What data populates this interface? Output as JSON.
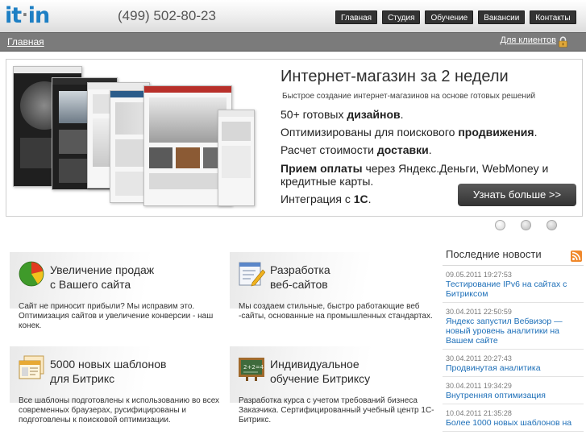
{
  "header": {
    "logo": {
      "left": "it",
      "dot": "·",
      "right": "in"
    },
    "phone": "(499) 502-80-23",
    "nav": [
      {
        "label": "Главная",
        "name": "nav-home"
      },
      {
        "label": "Студия",
        "name": "nav-studio"
      },
      {
        "label": "Обучение",
        "name": "nav-training"
      },
      {
        "label": "Вакансии",
        "name": "nav-vacancies"
      },
      {
        "label": "Контакты",
        "name": "nav-contacts"
      }
    ]
  },
  "subbar": {
    "breadcrumb": "Главная",
    "client_link": "Для клиентов"
  },
  "banner": {
    "title": "Интернет-магазин за 2 недели",
    "subtitle": "Быстрое создание интернет-магазинов на основе готовых решений",
    "lines": [
      {
        "prefix": "50+ готовых ",
        "bold": "дизайнов",
        "suffix": "."
      },
      {
        "prefix": "Оптимизированы для поискового ",
        "bold": "продвижения",
        "suffix": "."
      },
      {
        "prefix": "Расчет стоимости ",
        "bold": "доставки",
        "suffix": "."
      },
      {
        "prefix": "",
        "bold": "Прием оплаты",
        "suffix": " через Яндекс.Деньги, WebMoney и"
      },
      {
        "prefix": "кредитные карты.",
        "bold": "",
        "suffix": ""
      },
      {
        "prefix": "Интеграция с ",
        "bold": "1С",
        "suffix": "."
      }
    ],
    "button": "Узнать больше >>",
    "slider_dots": 3,
    "active_dot": 0
  },
  "features": [
    {
      "title_1": "Увеличение продаж",
      "title_2": "с Вашего сайта",
      "icon": "pie-chart-icon",
      "desc": "Сайт не приносит прибыли? Мы исправим это. Оптимизация сайтов и увеличение конверсии - наш конек."
    },
    {
      "title_1": "Разработка",
      "title_2": "веб-сайтов",
      "icon": "edit-window-icon",
      "desc": "Мы создаем стильные, быстро работающие веб -сайты, основанные на промышленных стандартах."
    },
    {
      "title_1": "5000 новых шаблонов",
      "title_2": "для Битрикс",
      "icon": "templates-icon",
      "desc": "Все шаблоны подготовлены к использованию во всех современных браузерах, русифицированы и подготовлены к поисковой оптимизации."
    },
    {
      "title_1": "Индивидуальное",
      "title_2": "обучение Битриксу",
      "icon": "chalkboard-icon",
      "desc": "Разработка курса с учетом требований бизнеса Заказчика. Сертифицированный учебный центр 1С-Битрикс."
    }
  ],
  "news": {
    "title": "Последние новости",
    "items": [
      {
        "date": "09.05.2011 19:27:53",
        "text": "Тестирование IPv6 на сайтах с Битриксом"
      },
      {
        "date": "30.04.2011 22:50:59",
        "text": "Яндекс запустил Вебвизор — новый уровень аналитики на Вашем сайте"
      },
      {
        "date": "30.04.2011 20:27:43",
        "text": "Продвинутая аналитика"
      },
      {
        "date": "30.04.2011 19:34:29",
        "text": "Внутренняя оптимизация"
      },
      {
        "date": "10.04.2011 21:35:28",
        "text": "Более 1000 новых шаблонов на"
      }
    ]
  },
  "colors": {
    "brand": "#1d7fc4",
    "nav_tab": "#333333",
    "subbar": "#7b7b7b",
    "link": "#1d6fb8",
    "button": "#3f3f3f"
  }
}
